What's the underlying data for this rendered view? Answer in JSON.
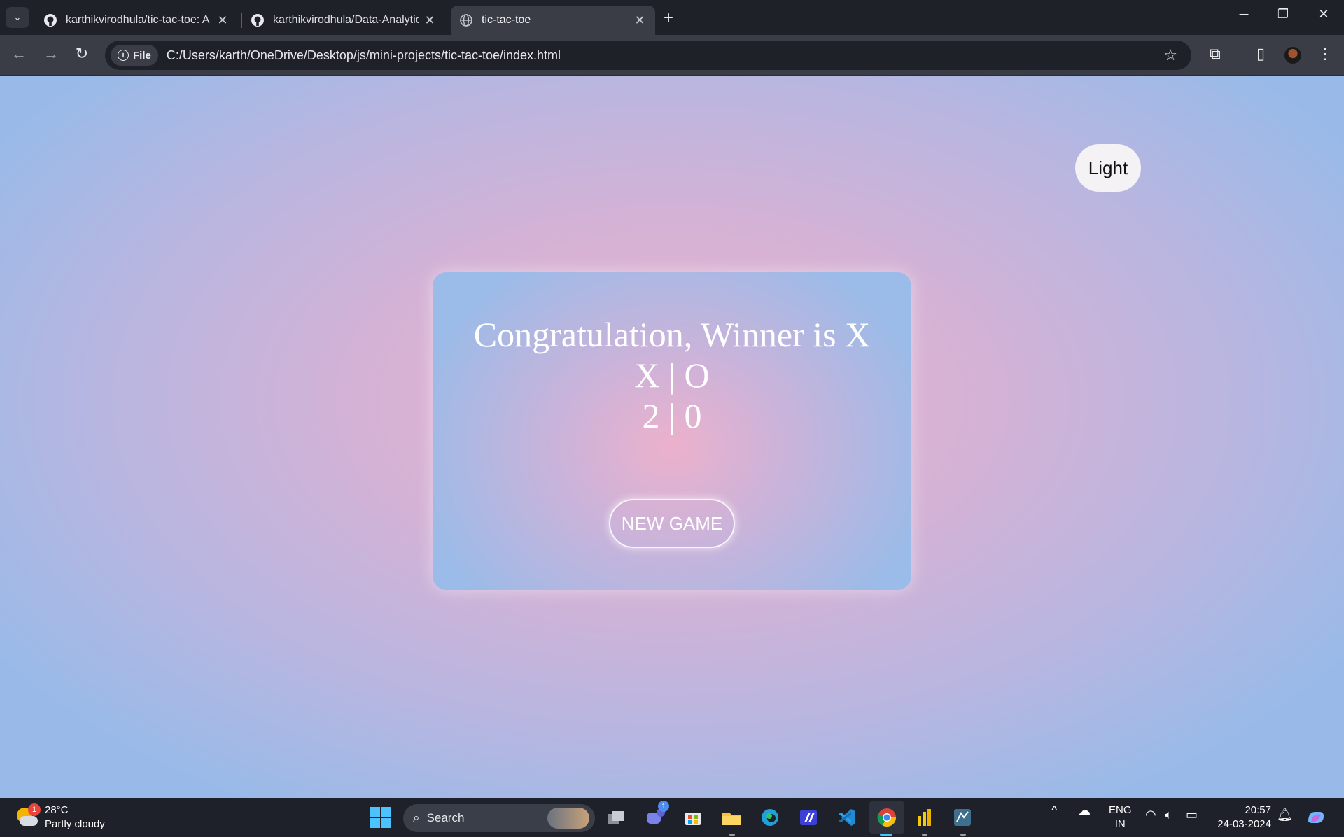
{
  "browser": {
    "tabs": [
      {
        "title": "karthikvirodhula/tic-tac-toe: A n",
        "icon": "github-icon",
        "active": false
      },
      {
        "title": "karthikvirodhula/Data-Analytics",
        "icon": "github-icon",
        "active": false
      },
      {
        "title": "tic-tac-toe",
        "icon": "globe-icon",
        "active": true
      }
    ],
    "close_glyph": "✕",
    "new_tab_glyph": "+",
    "address": {
      "chip_label": "File",
      "url": "C:/Users/karth/OneDrive/Desktop/js/mini-projects/tic-tac-toe/index.html"
    }
  },
  "page": {
    "theme_button": "Light",
    "winner_text": "Congratulation, Winner is X",
    "score_header": "X | O",
    "score_values": "2 | 0",
    "new_game_label": "NEW GAME"
  },
  "taskbar": {
    "weather": {
      "temp": "28°C",
      "condition": "Partly cloudy",
      "badge": "1"
    },
    "search_placeholder": "Search",
    "teams_badge": "1",
    "language": {
      "line1": "ENG",
      "line2": "IN"
    },
    "time": "20:57",
    "date": "24-03-2024"
  },
  "colors": {
    "page_center": "#ecb1cc",
    "page_edge": "#99bae8",
    "browser_frame": "#1f2128",
    "taskbar": "#1e2129"
  }
}
